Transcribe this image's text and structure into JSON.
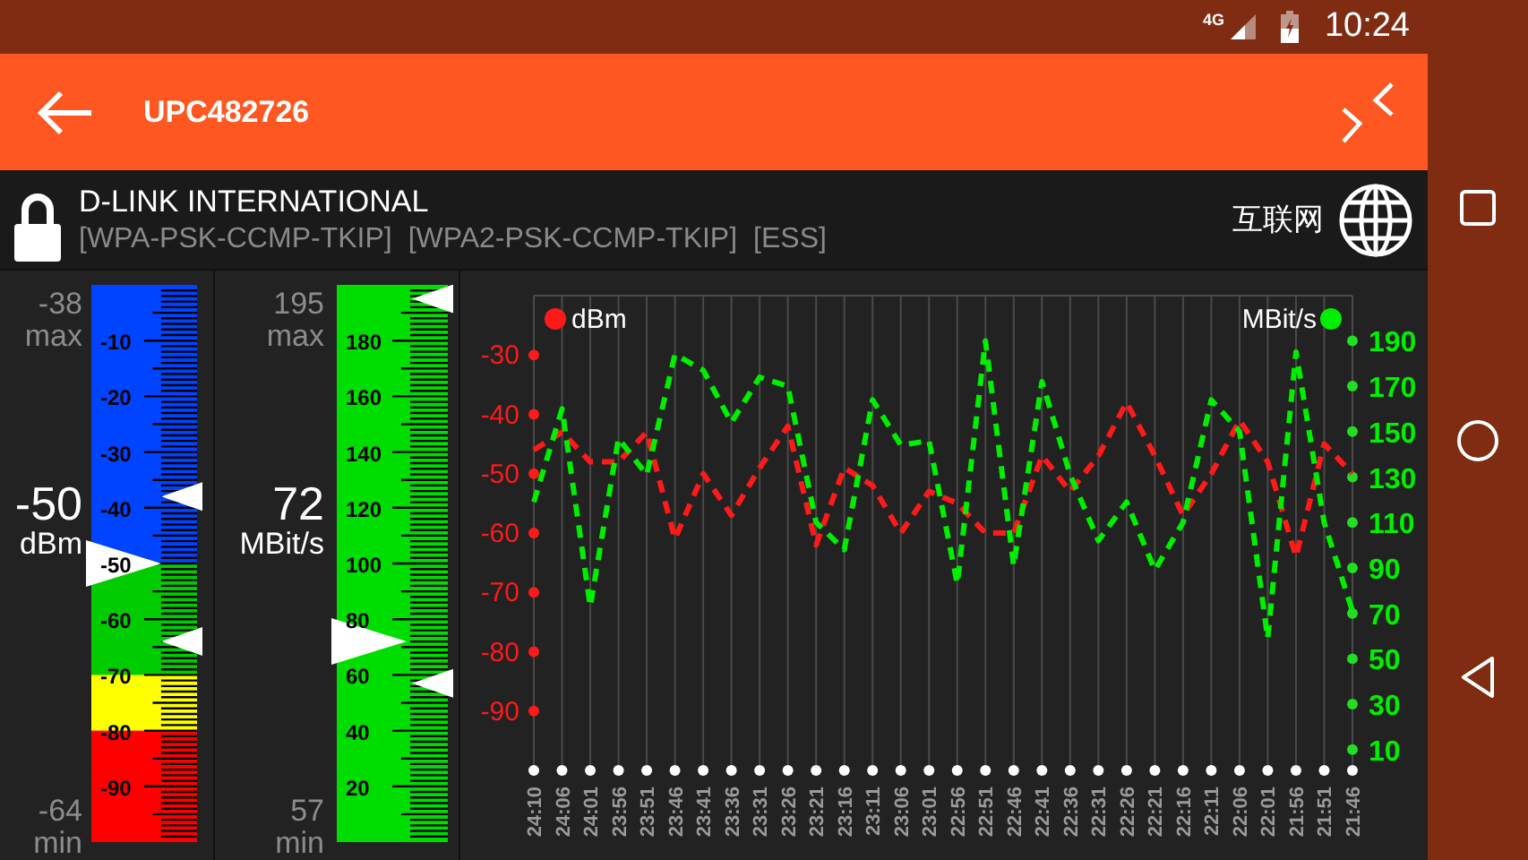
{
  "status_bar": {
    "network_type": "4G",
    "time": "10:24"
  },
  "app_bar": {
    "title": "UPC482726"
  },
  "network": {
    "name": "D-LINK INTERNATIONAL",
    "security": [
      "[WPA-PSK-CCMP-TKIP]",
      "[WPA2-PSK-CCMP-TKIP]",
      "[ESS]"
    ],
    "connectivity": "互联网"
  },
  "gauges": [
    {
      "max": "-38",
      "max_label": "max",
      "value": "-50",
      "unit": "dBm",
      "min": "-64",
      "min_label": "min",
      "scale": [
        "-10",
        "-20",
        "-30",
        "-40",
        "-50",
        "-60",
        "-70",
        "-80",
        "-90"
      ],
      "segments": [
        {
          "color": "#0044ff"
        },
        {
          "color": "#0044ff"
        },
        {
          "color": "#0044ff"
        },
        {
          "color": "#0044ff"
        },
        {
          "color": "#0044ff"
        },
        {
          "color": "#00cc00"
        },
        {
          "color": "#00cc00"
        },
        {
          "color": "#ffff00"
        },
        {
          "color": "#ff0000"
        },
        {
          "color": "#ff0000"
        }
      ],
      "pointers": [
        {
          "kind": "current",
          "level": 0.5
        },
        {
          "kind": "max",
          "level": 0.62
        },
        {
          "kind": "min",
          "level": 0.36
        }
      ]
    },
    {
      "max": "195",
      "max_label": "max",
      "value": "72",
      "unit": "MBit/s",
      "min": "57",
      "min_label": "min",
      "scale": [
        "180",
        "160",
        "140",
        "120",
        "100",
        "80",
        "60",
        "40",
        "20"
      ],
      "segments": [
        {
          "color": "#00dd00"
        },
        {
          "color": "#00dd00"
        },
        {
          "color": "#00dd00"
        },
        {
          "color": "#00dd00"
        },
        {
          "color": "#00dd00"
        },
        {
          "color": "#00dd00"
        },
        {
          "color": "#00dd00"
        },
        {
          "color": "#00dd00"
        },
        {
          "color": "#00dd00"
        },
        {
          "color": "#00dd00"
        }
      ],
      "pointers": [
        {
          "kind": "current",
          "level": 0.36
        },
        {
          "kind": "max",
          "level": 0.975
        },
        {
          "kind": "min",
          "level": 0.285
        }
      ]
    }
  ],
  "charts": [
    {
      "chart_data": {
        "type": "line",
        "grid": true,
        "categories": [
          "24:10",
          "24:06",
          "24:01",
          "23:56",
          "23:51",
          "23:46",
          "23:41",
          "23:36",
          "23:31",
          "23:26",
          "23:21",
          "23:16",
          "23:11",
          "23:06",
          "23:01",
          "22:56",
          "22:51",
          "22:46",
          "22:41",
          "22:36",
          "22:31",
          "22:26",
          "22:21",
          "22:16",
          "22:11",
          "22:06",
          "22:01",
          "21:56",
          "21:51",
          "21:46"
        ],
        "ylim": [
          -100,
          -20
        ],
        "yticks": [
          -30,
          -40,
          -50,
          -60,
          -70,
          -80,
          -90
        ],
        "series": [
          {
            "name": "dBm",
            "color": "#ff1a1a",
            "line_style": "dashed",
            "values": [
              -46,
              -43,
              -48,
              -48,
              -43,
              -61,
              -50,
              -57,
              -49,
              -42,
              -62,
              -49,
              -52,
              -60,
              -53,
              -55,
              -60,
              -60,
              -47,
              -53,
              -47,
              -38,
              -47,
              -57,
              -50,
              -41,
              -48,
              -64,
              -45,
              -50
            ]
          }
        ]
      }
    },
    {
      "chart_data": {
        "type": "line",
        "ylim": [
          10,
          190
        ],
        "yticks": [
          190,
          170,
          150,
          130,
          110,
          90,
          70,
          50,
          30,
          10
        ],
        "series": [
          {
            "name": "MBit/s",
            "color": "#00ee00",
            "line_style": "dashed",
            "values": [
              119,
              160,
              73,
              147,
              131,
              184,
              177,
              154,
              174,
              170,
              110,
              98,
              164,
              144,
              146,
              83,
              190,
              91,
              172,
              131,
              102,
              119,
              89,
              110,
              164,
              150,
              59,
              185,
              110,
              71
            ]
          }
        ]
      }
    }
  ]
}
